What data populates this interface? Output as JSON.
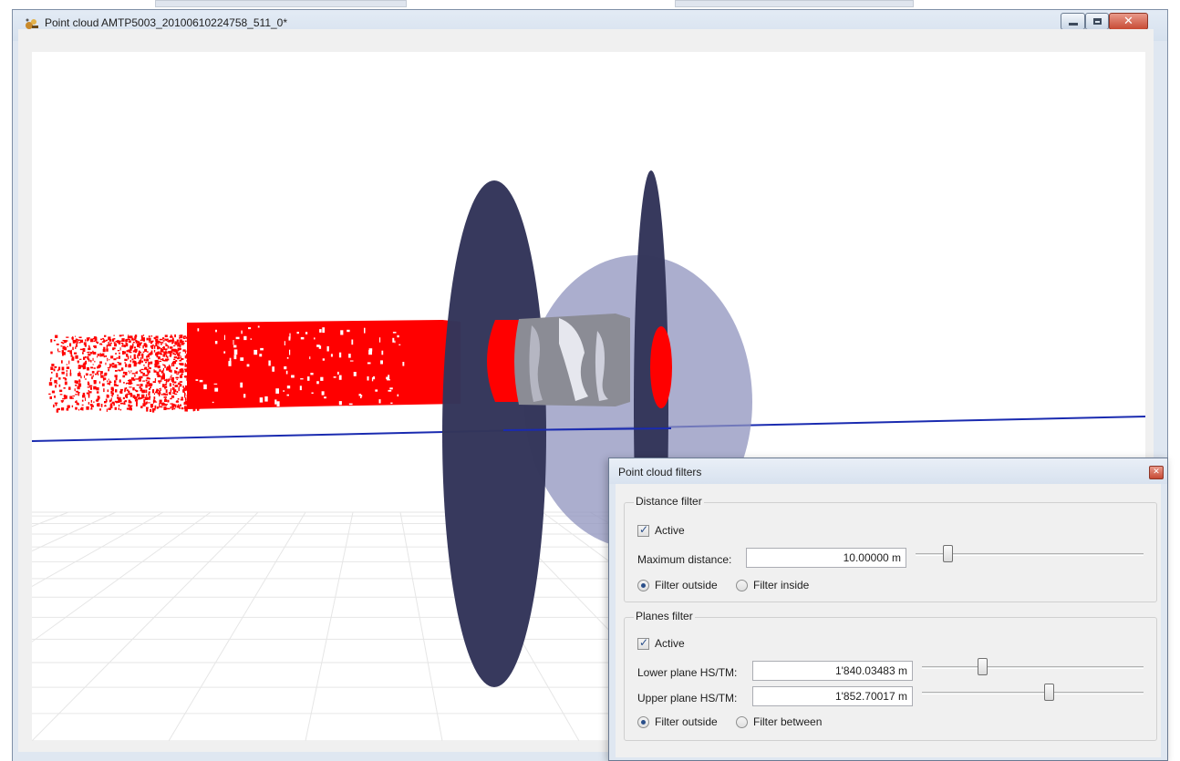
{
  "window": {
    "title": "Point cloud AMTP5003_20100610224758_511_0*",
    "controls": {
      "minimize": "minimize",
      "maximize": "maximize",
      "close": "close"
    }
  },
  "viewport": {
    "background": "#ffffff",
    "point_cloud_color": "#ff0000",
    "plane_color": "#33355a",
    "sphere_color": "#8f93bd",
    "axis_line_color": "#1a2bb0",
    "grid_color": "#e6e6e6"
  },
  "filters_dialog": {
    "title": "Point cloud filters",
    "distance_filter": {
      "group_title": "Distance filter",
      "active_label": "Active",
      "active": true,
      "max_distance_label": "Maximum distance:",
      "max_distance_value": "10.00000 m",
      "slider_position": 0.14,
      "radio_outside_label": "Filter outside",
      "radio_inside_label": "Filter inside",
      "selected": "outside"
    },
    "planes_filter": {
      "group_title": "Planes filter",
      "active_label": "Active",
      "active": true,
      "lower_plane_label": "Lower plane HS/TM:",
      "lower_plane_value": "1'840.03483 m",
      "lower_slider_position": 0.27,
      "upper_plane_label": "Upper plane HS/TM:",
      "upper_plane_value": "1'852.70017 m",
      "upper_slider_position": 0.57,
      "radio_outside_label": "Filter outside",
      "radio_between_label": "Filter between",
      "selected": "outside"
    }
  }
}
